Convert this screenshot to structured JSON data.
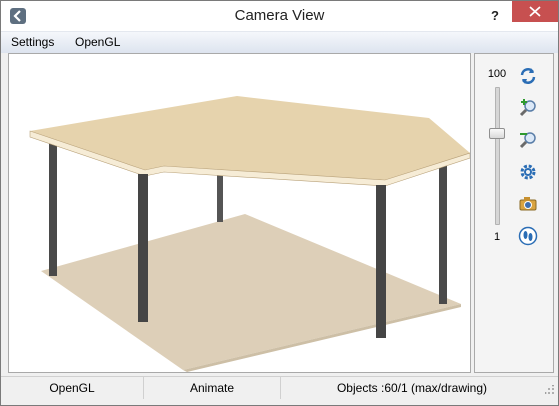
{
  "window": {
    "title": "Camera View",
    "help_label": "?",
    "close_label": "✕"
  },
  "menu": {
    "items": [
      {
        "label": "Settings"
      },
      {
        "label": "OpenGL"
      }
    ]
  },
  "side_panel": {
    "zoom_max": "100",
    "zoom_min": "1",
    "zoom_level_fraction": 0.67,
    "tools": [
      {
        "icon": "refresh-icon"
      },
      {
        "icon": "zoom-in-icon"
      },
      {
        "icon": "zoom-out-icon"
      },
      {
        "icon": "gear-icon"
      },
      {
        "icon": "camera-icon"
      },
      {
        "icon": "footprints-icon"
      }
    ]
  },
  "status": {
    "opengl": "OpenGL",
    "animate": "Animate",
    "objects": "Objects :60/1 (max/drawing)"
  },
  "colors": {
    "tabletop": "#e6d3ad",
    "floor": "#ddcfb8",
    "legs": "#4a4a4a",
    "accent": "#2a6db5"
  }
}
